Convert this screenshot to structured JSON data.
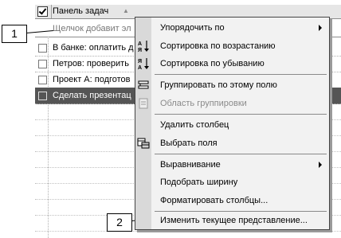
{
  "header": {
    "title": "Панель задач",
    "sort_glyph": "▲"
  },
  "new_task_placeholder": "Щелчок добавит эл",
  "tasks": [
    {
      "label": "В банке: оплатить д",
      "selected": false
    },
    {
      "label": "Петров: проверить",
      "selected": false
    },
    {
      "label": "Проект А: подготов",
      "selected": false
    },
    {
      "label": "Сделать презентац",
      "selected": true
    }
  ],
  "callouts": [
    "1",
    "2"
  ],
  "menu": {
    "items": [
      {
        "label": "Упорядочить по",
        "submenu": true,
        "icon": ""
      },
      {
        "label": "Сортировка по возрастанию",
        "icon": "sort-ascending-icon"
      },
      {
        "label": "Сортировка по убыванию",
        "icon": "sort-descending-icon"
      },
      {
        "label": "Группировать по этому полю",
        "icon": "group-by-field-icon"
      },
      {
        "label": "Область группировки",
        "disabled": true,
        "icon": "group-box-icon"
      },
      {
        "label": "Удалить столбец",
        "icon": ""
      },
      {
        "label": "Выбрать поля",
        "icon": "field-chooser-icon"
      },
      {
        "label": "Выравнивание",
        "submenu": true,
        "icon": ""
      },
      {
        "label": "Подобрать ширину",
        "icon": ""
      },
      {
        "label": "Форматировать столбцы...",
        "icon": ""
      },
      {
        "label": "Изменить текущее представление...",
        "icon": ""
      }
    ]
  }
}
